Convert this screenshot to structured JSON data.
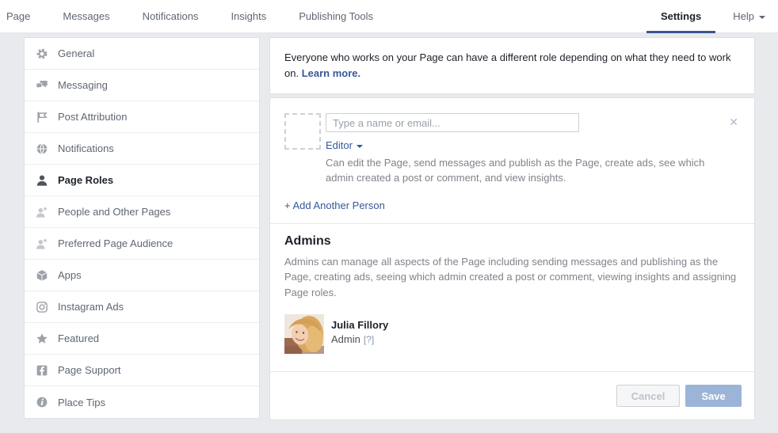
{
  "nav": {
    "items": [
      {
        "label": "Page"
      },
      {
        "label": "Messages"
      },
      {
        "label": "Notifications"
      },
      {
        "label": "Insights"
      },
      {
        "label": "Publishing Tools"
      }
    ],
    "right_items": [
      {
        "label": "Settings",
        "active": true
      },
      {
        "label": "Help",
        "has_dropdown": true
      }
    ]
  },
  "sidebar": {
    "items": [
      {
        "label": "General",
        "icon": "gear-icon"
      },
      {
        "label": "Messaging",
        "icon": "chat-bubbles-icon"
      },
      {
        "label": "Post Attribution",
        "icon": "flag-icon"
      },
      {
        "label": "Notifications",
        "icon": "globe-icon"
      },
      {
        "label": "Page Roles",
        "icon": "person-icon",
        "active": true
      },
      {
        "label": "People and Other Pages",
        "icon": "person-star-icon"
      },
      {
        "label": "Preferred Page Audience",
        "icon": "person-star-icon"
      },
      {
        "label": "Apps",
        "icon": "cube-icon"
      },
      {
        "label": "Instagram Ads",
        "icon": "instagram-icon"
      },
      {
        "label": "Featured",
        "icon": "star-icon"
      },
      {
        "label": "Page Support",
        "icon": "facebook-icon"
      },
      {
        "label": "Place Tips",
        "icon": "info-icon"
      }
    ]
  },
  "main": {
    "intro_text": "Everyone who works on your Page can have a different role depending on what they need to work on.",
    "learn_more_label": "Learn more.",
    "add_person": {
      "input_placeholder": "Type a name or email...",
      "role_label": "Editor",
      "role_description": "Can edit the Page, send messages and publish as the Page, create ads, see which admin created a post or comment, and view insights.",
      "remove_icon": "✕",
      "add_another_label": "+ Add Another Person"
    },
    "admins": {
      "title": "Admins",
      "description": "Admins can manage all aspects of the Page including sending messages and publishing as the Page, creating ads, seeing which admin created a post or comment, viewing insights and assigning Page roles.",
      "members": [
        {
          "name": "Julia Fillory",
          "role": "Admin",
          "help_label": "[?]"
        }
      ]
    },
    "footer": {
      "cancel_label": "Cancel",
      "save_label": "Save"
    }
  },
  "colors": {
    "accent_blue": "#3a5795",
    "link_blue": "#365899",
    "save_button_bg": "#9cb4d8",
    "cancel_text": "#bec3c9",
    "page_bg": "#e9eaed",
    "nav_text": "#5f6673",
    "muted_text": "#7f838a"
  }
}
